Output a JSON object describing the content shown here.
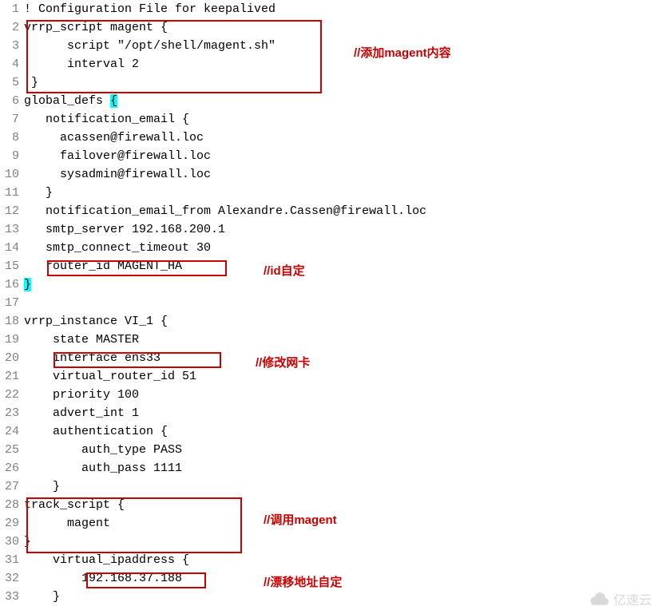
{
  "lines": [
    {
      "n": "1",
      "t": "! Configuration File for keepalived"
    },
    {
      "n": "2",
      "t": "vrrp_script magent {"
    },
    {
      "n": "3",
      "t": "      script \"/opt/shell/magent.sh\""
    },
    {
      "n": "4",
      "t": "      interval 2"
    },
    {
      "n": "5",
      "t": " }"
    },
    {
      "n": "6",
      "t": "global_defs ",
      "brace": "{"
    },
    {
      "n": "7",
      "t": "   notification_email {"
    },
    {
      "n": "8",
      "t": "     acassen@firewall.loc"
    },
    {
      "n": "9",
      "t": "     failover@firewall.loc"
    },
    {
      "n": "10",
      "t": "     sysadmin@firewall.loc"
    },
    {
      "n": "11",
      "t": "   }"
    },
    {
      "n": "12",
      "t": "   notification_email_from Alexandre.Cassen@firewall.loc"
    },
    {
      "n": "13",
      "t": "   smtp_server 192.168.200.1"
    },
    {
      "n": "14",
      "t": "   smtp_connect_timeout 30"
    },
    {
      "n": "15",
      "t": "   router_id MAGENT_HA"
    },
    {
      "n": "16",
      "t": "",
      "brace": "}"
    },
    {
      "n": "17",
      "t": ""
    },
    {
      "n": "18",
      "t": "vrrp_instance VI_1 {"
    },
    {
      "n": "19",
      "t": "    state MASTER"
    },
    {
      "n": "20",
      "t": "    interface ens33"
    },
    {
      "n": "21",
      "t": "    virtual_router_id 51"
    },
    {
      "n": "22",
      "t": "    priority 100"
    },
    {
      "n": "23",
      "t": "    advert_int 1"
    },
    {
      "n": "24",
      "t": "    authentication {"
    },
    {
      "n": "25",
      "t": "        auth_type PASS"
    },
    {
      "n": "26",
      "t": "        auth_pass 1111"
    },
    {
      "n": "27",
      "t": "    }"
    },
    {
      "n": "28",
      "t": "track_script {"
    },
    {
      "n": "29",
      "t": "      magent"
    },
    {
      "n": "30",
      "t": "}"
    },
    {
      "n": "31",
      "t": "    virtual_ipaddress {"
    },
    {
      "n": "32",
      "t": "        192.168.37.188"
    },
    {
      "n": "33",
      "t": "    }"
    }
  ],
  "annotations": {
    "a1": "//添加magent内容",
    "a2": "//id自定",
    "a3": "//修改网卡",
    "a4": "//调用magent",
    "a5": "//漂移地址自定"
  },
  "watermark": "亿速云"
}
